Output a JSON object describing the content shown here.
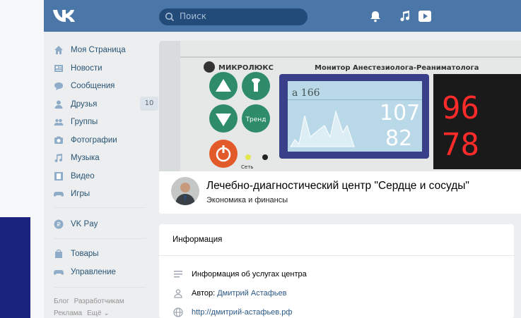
{
  "header": {
    "search_placeholder": "Поиск"
  },
  "sidebar": {
    "items": [
      {
        "label": "Моя Страница"
      },
      {
        "label": "Новости"
      },
      {
        "label": "Сообщения"
      },
      {
        "label": "Друзья",
        "badge": "10"
      },
      {
        "label": "Группы"
      },
      {
        "label": "Фотографии"
      },
      {
        "label": "Музыка"
      },
      {
        "label": "Видео"
      },
      {
        "label": "Игры"
      },
      {
        "label": "VK Pay"
      },
      {
        "label": "Товары"
      },
      {
        "label": "Управление"
      }
    ],
    "footer": [
      "Блог",
      "Разработчикам",
      "Реклама",
      "Ещё ⌄"
    ]
  },
  "cover": {
    "brand": "МИКРОЛЮКС",
    "device_title": "Монитор Анестезиолога-Реаниматолога",
    "screen_label": "a 166",
    "value_top": "107",
    "value_bottom": "82",
    "led_top": "96",
    "led_bottom": "78",
    "btn_trend": "Тренд",
    "lbl_net": "Сеть"
  },
  "group": {
    "title": "Лечебно-диагностический центр \"Сердце и сосуды\"",
    "subtitle": "Экономика и финансы"
  },
  "info": {
    "title": "Информация",
    "description": "Информация об услугах центра",
    "author_label": "Автор:",
    "author_name": "Дмитрий Астафьев",
    "website": "http://дмитрий-астафьев.рф"
  }
}
